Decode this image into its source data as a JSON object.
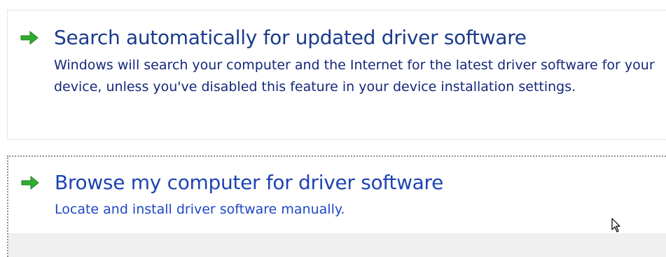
{
  "options": [
    {
      "title": "Search automatically for updated driver software",
      "description": "Windows will search your computer and the Internet for the latest driver software for your device, unless you've disabled this feature in your device installation settings.",
      "icon": "green-arrow-icon"
    },
    {
      "title": "Browse my computer for driver software",
      "description": "Locate and install driver software manually.",
      "icon": "green-arrow-icon"
    }
  ],
  "colors": {
    "arrow": "#2fae2f",
    "title_text": "#1b3b8a",
    "hover_title_text": "#1e43b3",
    "desc_text": "#13287a",
    "hover_desc_text": "#1e47c6"
  },
  "cursor_icon": "pointer-cursor-icon"
}
